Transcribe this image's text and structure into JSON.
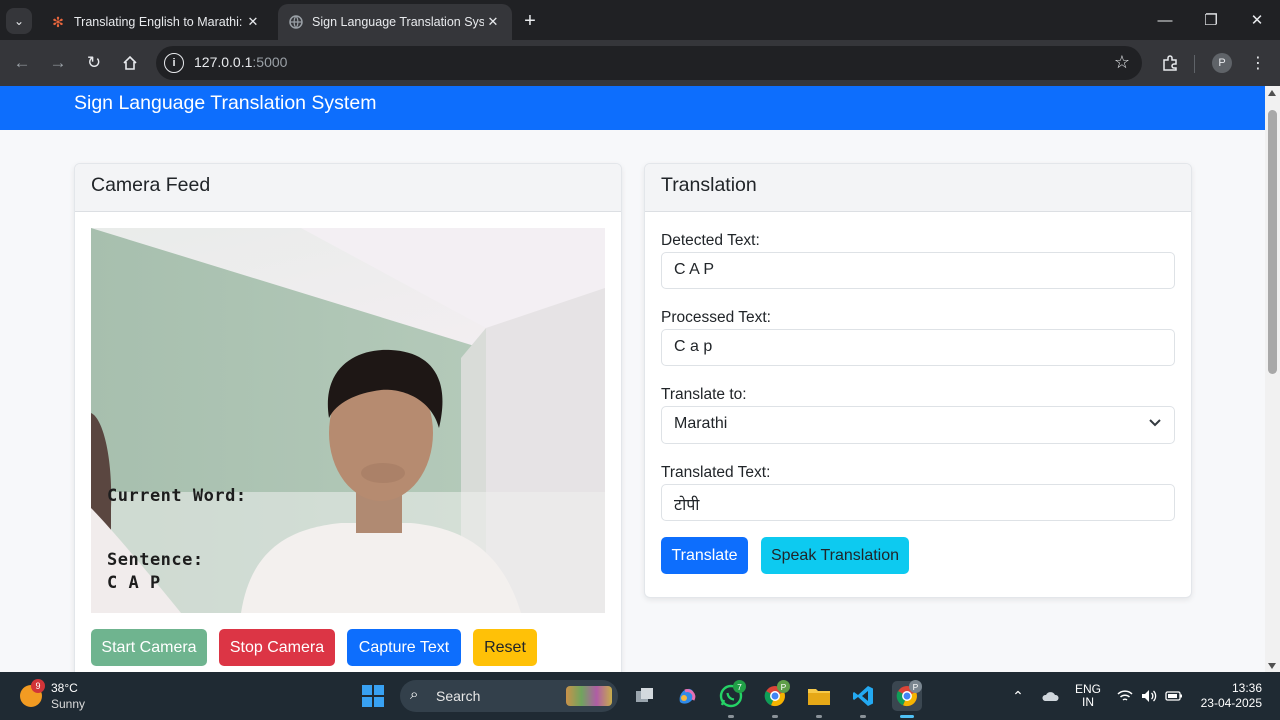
{
  "browser": {
    "tabs": [
      {
        "title": "Translating English to Marathi: l",
        "favicon": "asterisk-icon",
        "active": false
      },
      {
        "title": "Sign Language Translation Syste",
        "favicon": "globe-icon",
        "active": true
      }
    ],
    "url_host": "127.0.0.1",
    "url_port": ":5000",
    "profile_initial": "P"
  },
  "page": {
    "navbar_title": "Sign Language Translation System",
    "camera_card": {
      "title": "Camera Feed",
      "overlay_current_word_label": "Current Word:",
      "overlay_sentence_label": "Sentence:",
      "overlay_sentence_value": "C A P",
      "buttons": {
        "start": "Start Camera",
        "stop": "Stop Camera",
        "capture": "Capture Text",
        "reset": "Reset"
      }
    },
    "translation_card": {
      "title": "Translation",
      "detected_label": "Detected Text:",
      "detected_value": "C A P",
      "processed_label": "Processed Text:",
      "processed_value": "C a p",
      "translate_to_label": "Translate to:",
      "translate_to_value": "Marathi",
      "translated_label": "Translated Text:",
      "translated_value": "टोपी",
      "translate_button": "Translate",
      "speak_button": "Speak Translation"
    }
  },
  "colors": {
    "primary": "#0d6efd",
    "success_disabled": "#6fb48f",
    "danger": "#dc3545",
    "warning": "#ffc107",
    "info": "#0dcaf0"
  },
  "taskbar": {
    "weather_temp": "38°C",
    "weather_desc": "Sunny",
    "weather_badge": "9",
    "search_label": "Search",
    "whatsapp_badge": "7",
    "lang_top": "ENG",
    "lang_bottom": "IN",
    "time": "13:36",
    "date": "23-04-2025"
  }
}
